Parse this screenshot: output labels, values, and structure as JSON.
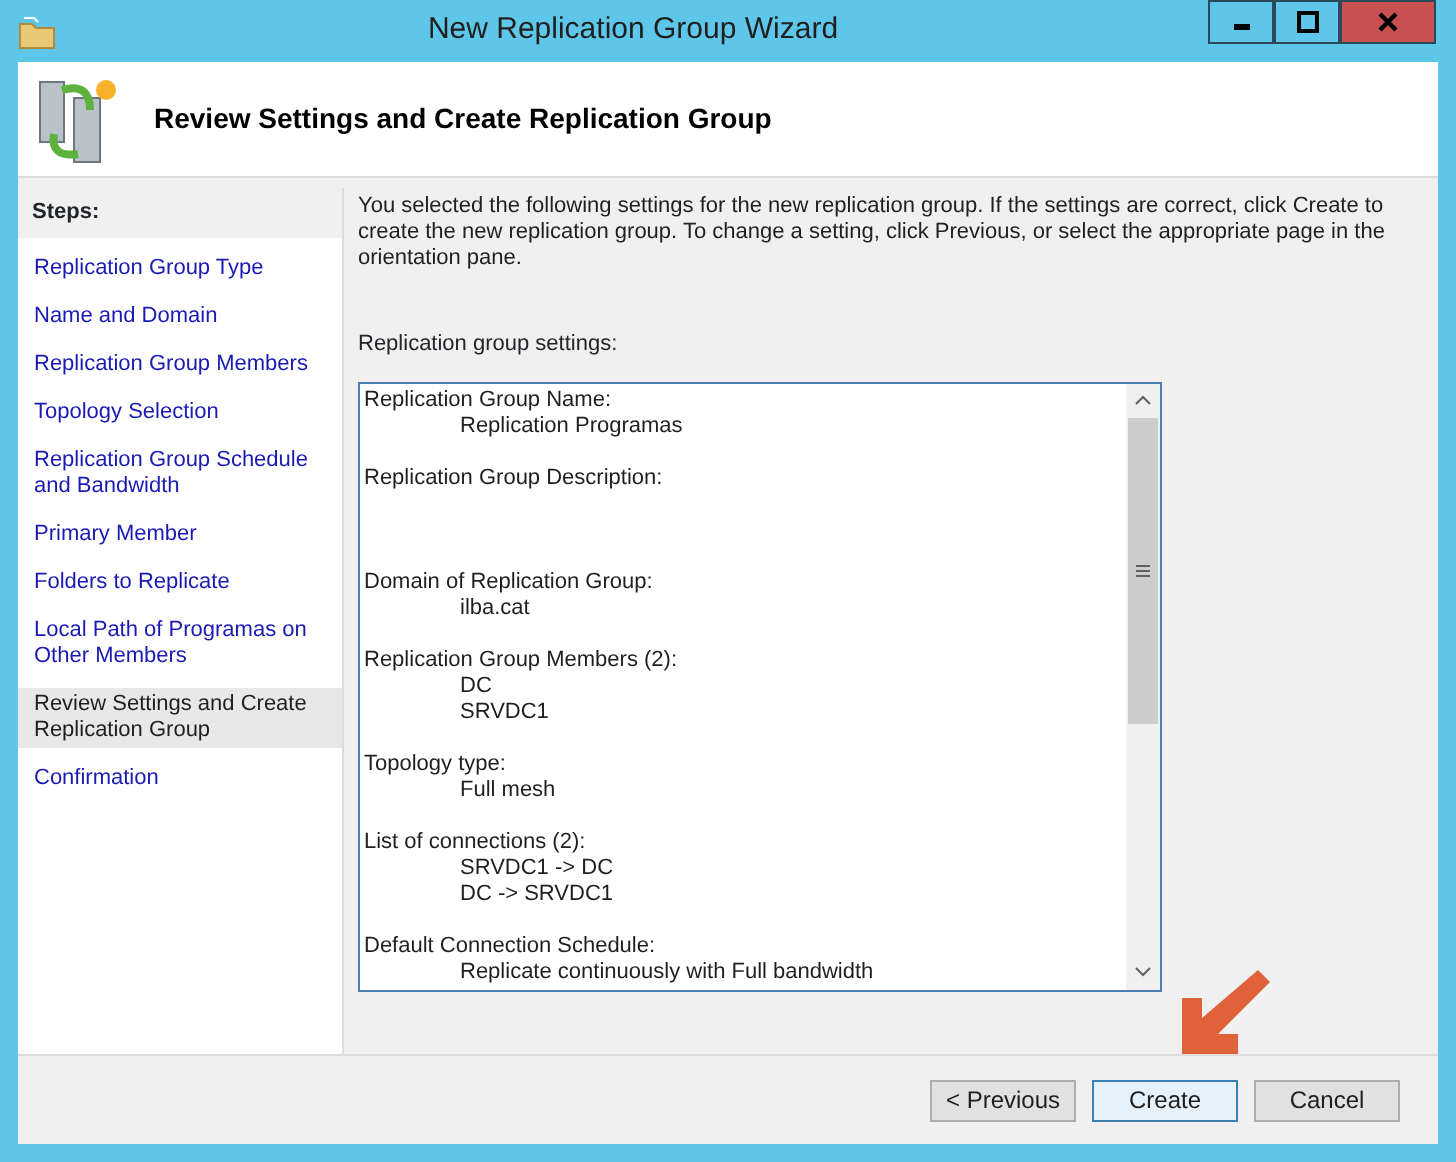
{
  "window": {
    "title": "New Replication Group Wizard"
  },
  "header": {
    "title": "Review Settings and Create Replication Group"
  },
  "steps_heading": "Steps:",
  "steps": [
    {
      "label": "Replication Group Type",
      "selected": false
    },
    {
      "label": "Name and Domain",
      "selected": false
    },
    {
      "label": "Replication Group Members",
      "selected": false
    },
    {
      "label": "Topology Selection",
      "selected": false
    },
    {
      "label": "Replication Group Schedule and Bandwidth",
      "selected": false
    },
    {
      "label": "Primary Member",
      "selected": false
    },
    {
      "label": "Folders to Replicate",
      "selected": false
    },
    {
      "label": "Local Path of Programas on Other Members",
      "selected": false
    },
    {
      "label": "Review Settings and Create Replication Group",
      "selected": true
    },
    {
      "label": "Confirmation",
      "selected": false
    }
  ],
  "intro": "You selected the following settings for the new replication group. If the settings are correct, click Create to create the new replication group. To change a setting, click Previous, or select the appropriate page in the orientation pane.",
  "settings_label": "Replication group settings:",
  "settings": [
    {
      "heading": "Replication Group Name:",
      "values": [
        "Replication Programas"
      ]
    },
    {
      "heading": "Replication Group Description:"
    },
    {
      "heading": "Domain of Replication Group:",
      "values": [
        "ilba.cat"
      ]
    },
    {
      "heading": "Replication Group Members (2):",
      "values": [
        "DC",
        "SRVDC1"
      ]
    },
    {
      "heading": "Topology type:",
      "values": [
        "Full mesh"
      ]
    },
    {
      "heading": "List of connections (2):",
      "values": [
        "SRVDC1 -> DC",
        "DC -> SRVDC1"
      ]
    },
    {
      "heading": "Default Connection Schedule:",
      "values": [
        "Replicate continuously with Full bandwidth"
      ]
    }
  ],
  "buttons": [
    {
      "label": "< Previous",
      "default": false
    },
    {
      "label": "Create",
      "default": true
    },
    {
      "label": "Cancel",
      "default": false
    }
  ]
}
